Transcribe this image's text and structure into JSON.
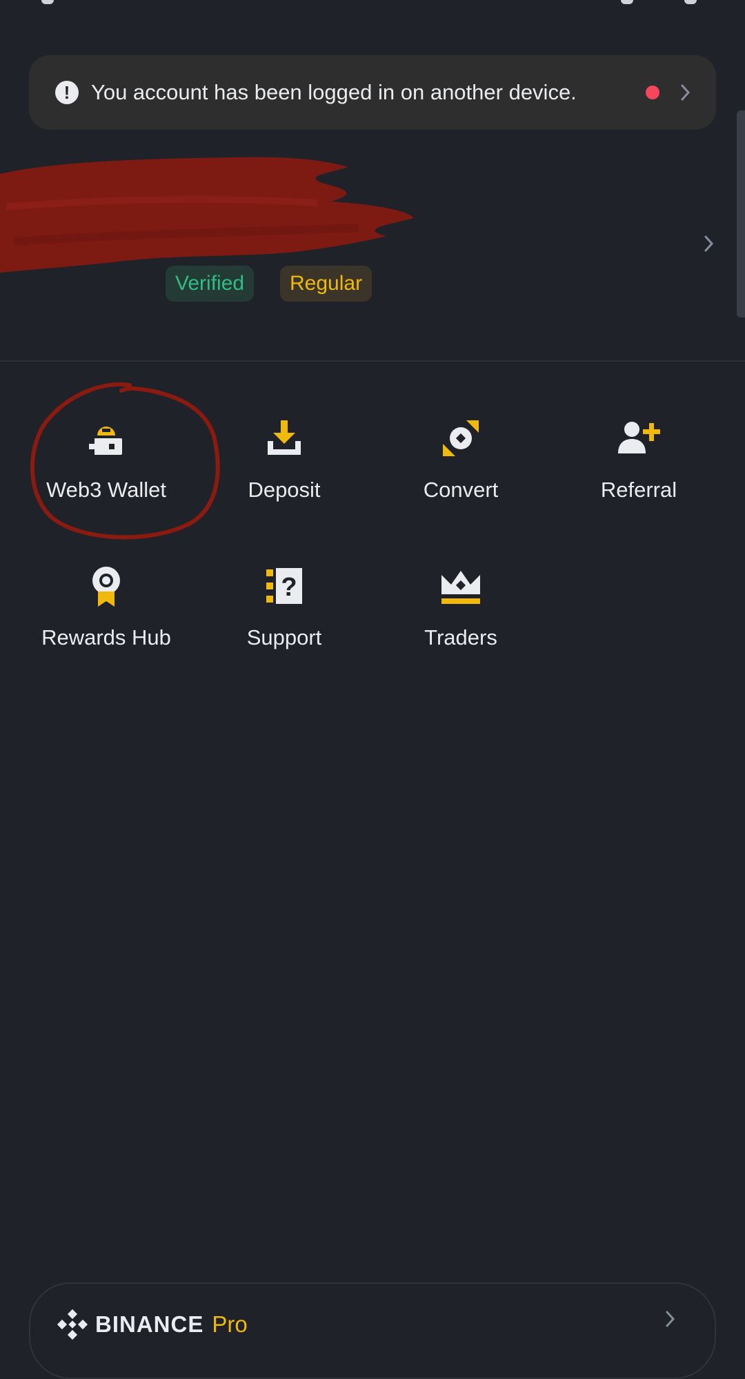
{
  "alert": {
    "icon": "alert-circle-icon",
    "message": "You account has been logged in on another device.",
    "dot_color": "#f6465d"
  },
  "profile": {
    "name_redacted": true,
    "badges": [
      "Verified",
      "Regular"
    ]
  },
  "menu": [
    {
      "label": "Web3 Wallet",
      "icon": "wallet-icon"
    },
    {
      "label": "Deposit",
      "icon": "deposit-icon"
    },
    {
      "label": "Convert",
      "icon": "convert-icon"
    },
    {
      "label": "Referral",
      "icon": "referral-icon"
    },
    {
      "label": "Rewards Hub",
      "icon": "rewards-icon"
    },
    {
      "label": "Support",
      "icon": "support-icon"
    },
    {
      "label": "Traders",
      "icon": "crown-icon"
    }
  ],
  "footer": {
    "brand": "BINANCE",
    "suffix": "Pro"
  },
  "colors": {
    "background": "#1f2229",
    "accent": "#f0b90b",
    "verified": "#2ebd85",
    "annotation": "#8b1a10"
  }
}
